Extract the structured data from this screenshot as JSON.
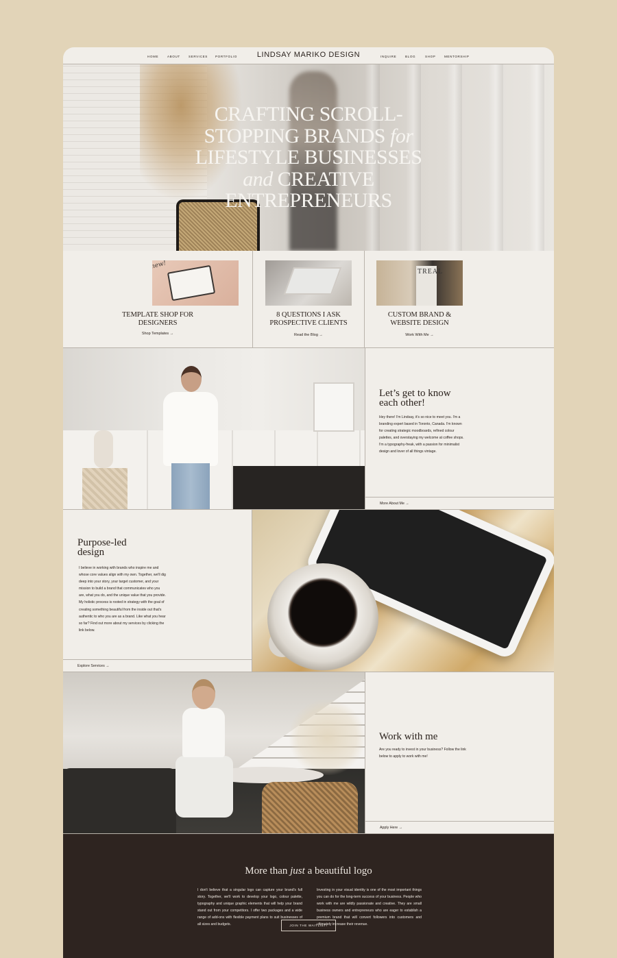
{
  "nav": {
    "left": [
      "HOME",
      "ABOUT",
      "SERVICES",
      "PORTFOLIO"
    ],
    "brand": "LINDSAY MARIKO DESIGN",
    "right": [
      "INQUIRE",
      "BLOG",
      "SHOP",
      "MENTORSHIP"
    ]
  },
  "hero": {
    "line1": "CRAFTING SCROLL-",
    "line2a": "STOPPING BRANDS ",
    "line2b": "for",
    "line3": "LIFESTYLE BUSINESSES",
    "line4a": "and",
    "line4b": " CREATIVE",
    "line5": "ENTREPRENEURS"
  },
  "cards": [
    {
      "title_a": "TEMPLATE SHOP FOR",
      "title_b": "DESIGNERS",
      "link": "Shop Templates →",
      "badge": "new!"
    },
    {
      "title_a": "8 QUESTIONS I ASK",
      "title_b": "PROSPECTIVE CLIENTS",
      "link": "Read the Blog →"
    },
    {
      "title_a": "CUSTOM BRAND &",
      "title_b": "WEBSITE DESIGN",
      "link": "Work With Me →",
      "magazine": "TREAL"
    }
  ],
  "about": {
    "heading_a": "Let’s get to know",
    "heading_b": "each other!",
    "body": "Hey there! I'm Lindsay, it's so nice to meet you. I'm a branding expert based in Toronto, Canada. I'm known for creating strategic moodboards, refined colour palettes, and overstaying my welcome at coffee shops. I'm a typography-freak, with a passion for minimalist design and lover of all things vintage.",
    "link": "More About Me →"
  },
  "purpose": {
    "heading_a": "Purpose-led",
    "heading_b": "design",
    "body": "I believe in working with brands who inspire me and whose core values align with my own. Together, we'll dig deep into your story, your target customer, and your mission to build a brand that communicates who you are, what you do, and the unique value that you provide. My holistic process is rooted in strategy with the goal of creating something beautiful from the inside out that's authentic to who you are as a brand. Like what you hear so far? Find out more about my services by clicking the link below.",
    "link": "Explore Services →"
  },
  "work": {
    "heading": "Work with me",
    "body": "Are you ready to invest in your business? Follow the link below to apply to work with me!",
    "link": "Apply Here →"
  },
  "more": {
    "heading_a": "More than ",
    "heading_b": "just",
    "heading_c": " a beautiful logo",
    "col1": "I don't believe that a singular logo can capture your brand's full story. Together, we'll work to develop your logo, colour palette, typography and unique graphic elements that will help your brand stand out from your competitors. I offer two packages and a wide range of add-ons with flexible payment plans to suit businesses of all sizes and budgets.",
    "col2": "Investing in your visual identity is one of the most important things you can do for the long-term success of your business. People who work with me are wildly passionate and creative. They are small business owners and entrepreneurs who are eager to establish a premium brand that will convert followers into customers and ultimately increase their revenue.",
    "button": "JOIN THE WAITLIST!"
  },
  "colors": {
    "page_bg": "#e2d4b8",
    "site_bg": "#f1eee9",
    "dark_band": "#2e2420",
    "text": "#2a211c"
  }
}
